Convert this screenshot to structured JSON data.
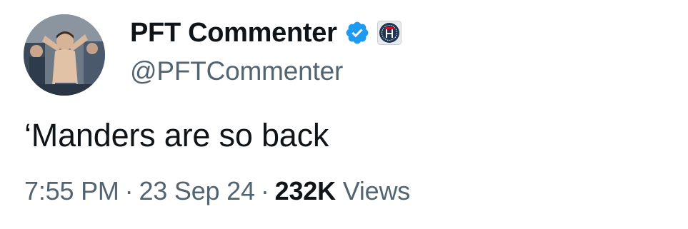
{
  "author": {
    "display_name": "PFT Commenter",
    "handle": "@PFTCommenter",
    "verified_color": "#1d9bf0",
    "affiliate_badge_icon": "barstool-logo-icon"
  },
  "tweet": {
    "text": "‘Manders are so back"
  },
  "meta": {
    "time": "7:55 PM",
    "separator": "·",
    "date": "23 Sep 24",
    "views_count": "232K",
    "views_label": "Views"
  },
  "colors": {
    "text_primary": "#0f1419",
    "text_secondary": "#536471",
    "verified_blue": "#1d9bf0",
    "badge_navy": "#1f3552"
  }
}
